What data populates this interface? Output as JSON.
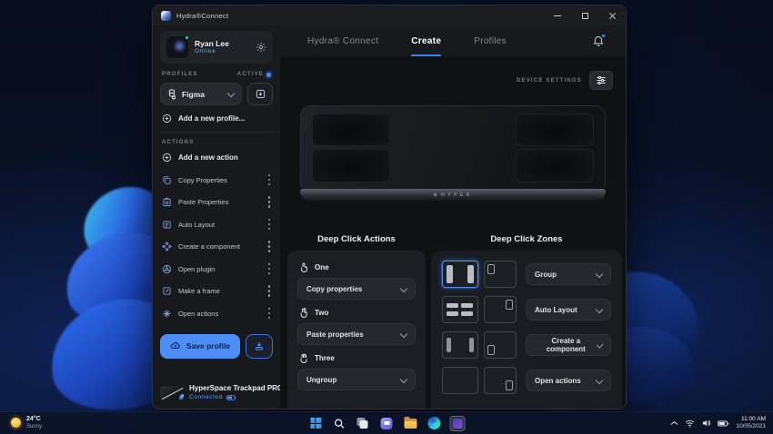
{
  "window": {
    "title": "Hydra®Connect",
    "tabs": [
      {
        "label": "Hydra® Connect"
      },
      {
        "label": "Create"
      },
      {
        "label": "Profiles"
      }
    ],
    "device_settings_label": "DEVICE SETTINGS",
    "device_brand": "HYPER"
  },
  "sidebar": {
    "user": {
      "name": "Ryan Lee",
      "status": "Online"
    },
    "profiles": {
      "label": "PROFILES",
      "active_label": "ACTIVE",
      "selected": "Figma",
      "add_new": "Add a new profile..."
    },
    "actions": {
      "label": "ACTIONS",
      "add_new": "Add a new action",
      "items": [
        {
          "label": "Copy Properties"
        },
        {
          "label": "Paste Properties"
        },
        {
          "label": "Auto Layout"
        },
        {
          "label": "Create a component"
        },
        {
          "label": "Open plugin"
        },
        {
          "label": "Make a frame"
        },
        {
          "label": "Open actions"
        }
      ]
    },
    "save_button": "Save profile",
    "device": {
      "name": "HyperSpace Trackpad PRO",
      "status": "Connected"
    }
  },
  "deep_click_actions": {
    "title": "Deep Click Actions",
    "rows": [
      {
        "label": "One",
        "value": "Copy properties"
      },
      {
        "label": "Two",
        "value": "Paste properties"
      },
      {
        "label": "Three",
        "value": "Ungroup"
      }
    ]
  },
  "deep_click_zones": {
    "title": "Deep Click Zones",
    "rows": [
      {
        "value": "Group"
      },
      {
        "value": "Auto Layout"
      },
      {
        "value": "Create a component"
      },
      {
        "value": "Open actions"
      }
    ]
  },
  "taskbar": {
    "weather": {
      "temp": "24°C",
      "condition": "Sunny"
    },
    "clock": {
      "time": "11:00 AM",
      "date": "10/05/2021"
    }
  },
  "colors": {
    "accent": "#4c8df6",
    "online": "#7cb1ff",
    "active_dot": "#3f8cff"
  }
}
